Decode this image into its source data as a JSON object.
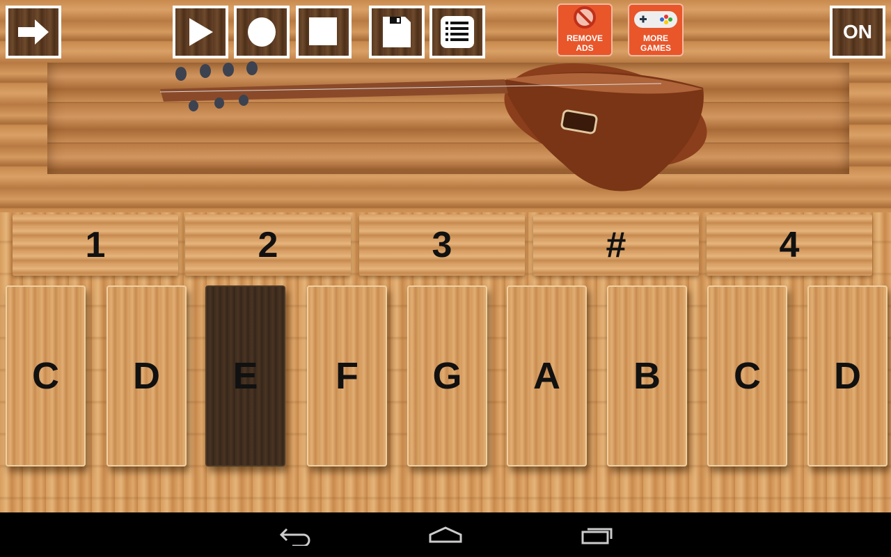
{
  "toolbar": {
    "remove_ads": [
      "REMOVE",
      "ADS"
    ],
    "more_games": [
      "MORE",
      "GAMES"
    ],
    "power": "ON"
  },
  "icons": [
    "arrow-right-icon",
    "play-icon",
    "record-icon",
    "stop-icon",
    "save-icon",
    "list-icon",
    "no-ads-icon",
    "gamepad-icon"
  ],
  "octaves": [
    "1",
    "2",
    "3",
    "#",
    "4"
  ],
  "keys": [
    {
      "note": "C",
      "pressed": false
    },
    {
      "note": "D",
      "pressed": false
    },
    {
      "note": "E",
      "pressed": true
    },
    {
      "note": "F",
      "pressed": false
    },
    {
      "note": "G",
      "pressed": false
    },
    {
      "note": "A",
      "pressed": false
    },
    {
      "note": "B",
      "pressed": false
    },
    {
      "note": "C",
      "pressed": false
    },
    {
      "note": "D",
      "pressed": false
    }
  ],
  "colors": {
    "accent": "#e8562a",
    "pressed_key": "#3b2a1b"
  }
}
